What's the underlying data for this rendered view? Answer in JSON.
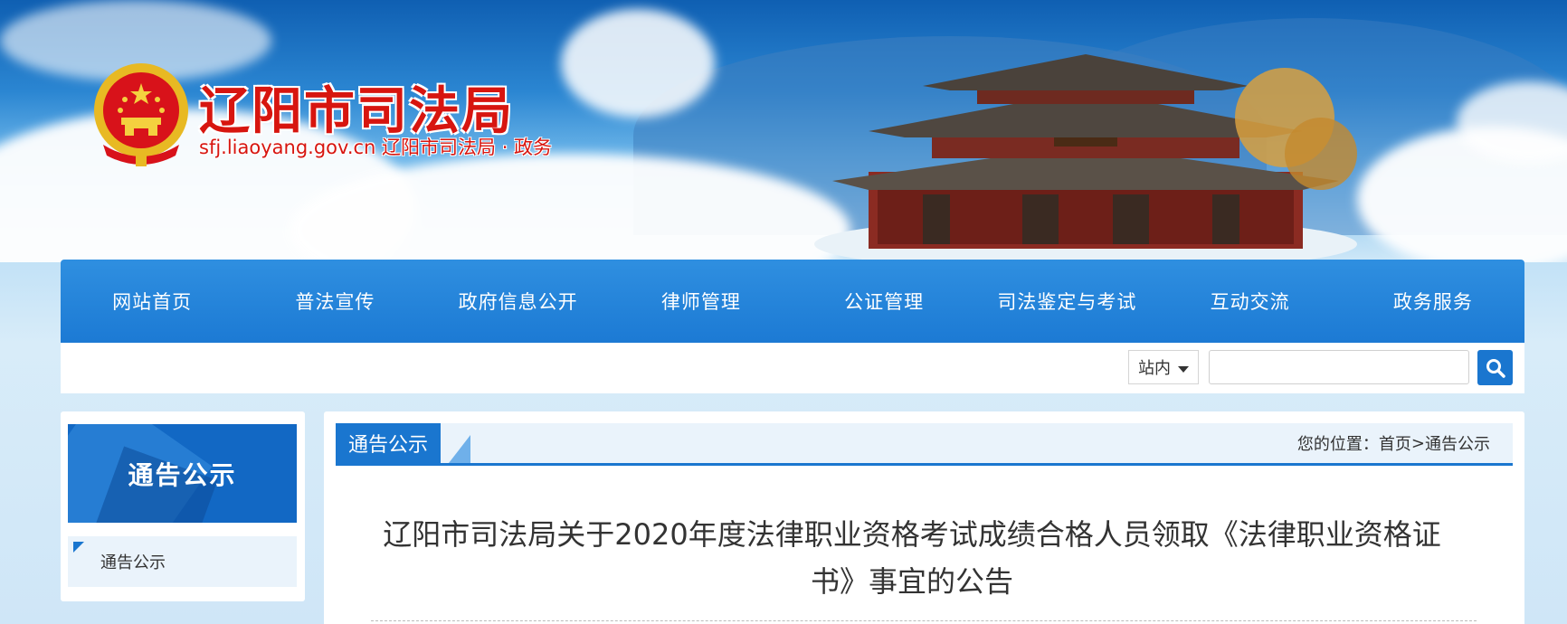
{
  "header": {
    "title": "辽阳市司法局",
    "subtitle": "sfj.liaoyang.gov.cn 辽阳市司法局 · 政务"
  },
  "nav": {
    "items": [
      {
        "label": "网站首页"
      },
      {
        "label": "普法宣传"
      },
      {
        "label": "政府信息公开"
      },
      {
        "label": "律师管理"
      },
      {
        "label": "公证管理"
      },
      {
        "label": "司法鉴定与考试"
      },
      {
        "label": "互动交流"
      },
      {
        "label": "政务服务"
      }
    ]
  },
  "search": {
    "scope": "站内",
    "value": "",
    "button_icon": "search-icon"
  },
  "sidebar": {
    "title": "通告公示",
    "items": [
      {
        "label": "通告公示"
      }
    ]
  },
  "main": {
    "tab": "通告公示",
    "breadcrumb": {
      "prefix": "您的位置：",
      "home": "首页",
      "separator": ">",
      "current": "通告公示"
    },
    "article_title": "辽阳市司法局关于2020年度法律职业资格考试成绩合格人员领取《法律职业资格证书》事宜的公告"
  },
  "colors": {
    "brand_red": "#d7150f",
    "nav_blue": "#1c7ad4",
    "accent_blue": "#1a76cf"
  }
}
